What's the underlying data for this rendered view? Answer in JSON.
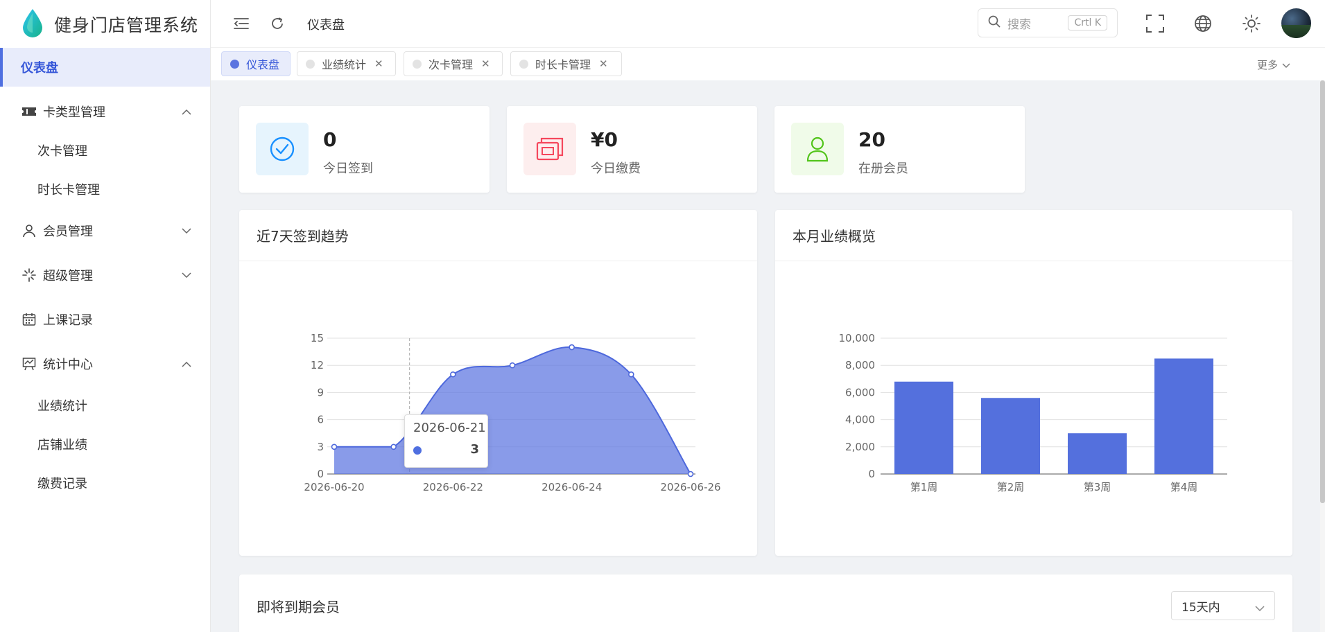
{
  "app": {
    "title": "健身门店管理系统"
  },
  "sidebar": {
    "items": [
      {
        "label": "仪表盘"
      },
      {
        "label": "卡类型管理"
      },
      {
        "label": "次卡管理"
      },
      {
        "label": "时长卡管理"
      },
      {
        "label": "会员管理"
      },
      {
        "label": "超级管理"
      },
      {
        "label": "上课记录"
      },
      {
        "label": "统计中心"
      },
      {
        "label": "业绩统计"
      },
      {
        "label": "店铺业绩"
      },
      {
        "label": "缴费记录"
      }
    ]
  },
  "header": {
    "breadcrumb": "仪表盘",
    "search_placeholder": "搜索",
    "search_shortcut": "Crtl K"
  },
  "tabs": [
    {
      "label": "仪表盘"
    },
    {
      "label": "业绩统计"
    },
    {
      "label": "次卡管理"
    },
    {
      "label": "时长卡管理"
    }
  ],
  "tabs_more": "更多",
  "stats": [
    {
      "value": "0",
      "label": "今日签到",
      "color": "#1890ff",
      "bg": "#e6f4fd"
    },
    {
      "value": "¥0",
      "label": "今日缴费",
      "color": "#f5475c",
      "bg": "#fdeeee"
    },
    {
      "value": "20",
      "label": "在册会员",
      "color": "#52c41a",
      "bg": "#f0fbe9"
    }
  ],
  "panels": {
    "trend_title": "近7天签到趋势",
    "monthly_title": "本月业绩概览",
    "expiring_title": "即将到期会员",
    "expiring_filter": "15天内"
  },
  "tooltip": {
    "date": "2026-06-21",
    "value": "3"
  },
  "chart_data": [
    {
      "type": "area",
      "title": "近7天签到趋势",
      "x": [
        "2026-06-20",
        "2026-06-21",
        "2026-06-22",
        "2026-06-23",
        "2026-06-24",
        "2026-06-25",
        "2026-06-26"
      ],
      "x_tick_labels": [
        "2026-06-20",
        "2026-06-22",
        "2026-06-24",
        "2026-06-26"
      ],
      "values": [
        3,
        3,
        11,
        12,
        14,
        11,
        0
      ],
      "y_ticks": [
        "0",
        "3",
        "6",
        "9",
        "12",
        "15"
      ],
      "ylim": [
        0,
        15
      ],
      "grid": true,
      "color": "#5b74e0"
    },
    {
      "type": "bar",
      "title": "本月业绩概览",
      "categories": [
        "第1周",
        "第2周",
        "第3周",
        "第4周"
      ],
      "values": [
        6800,
        5600,
        3000,
        8500
      ],
      "y_ticks": [
        "0",
        "2,000",
        "4,000",
        "6,000",
        "8,000",
        "10,000"
      ],
      "ylim": [
        0,
        10000
      ],
      "grid": true,
      "color": "#5470dd"
    }
  ]
}
